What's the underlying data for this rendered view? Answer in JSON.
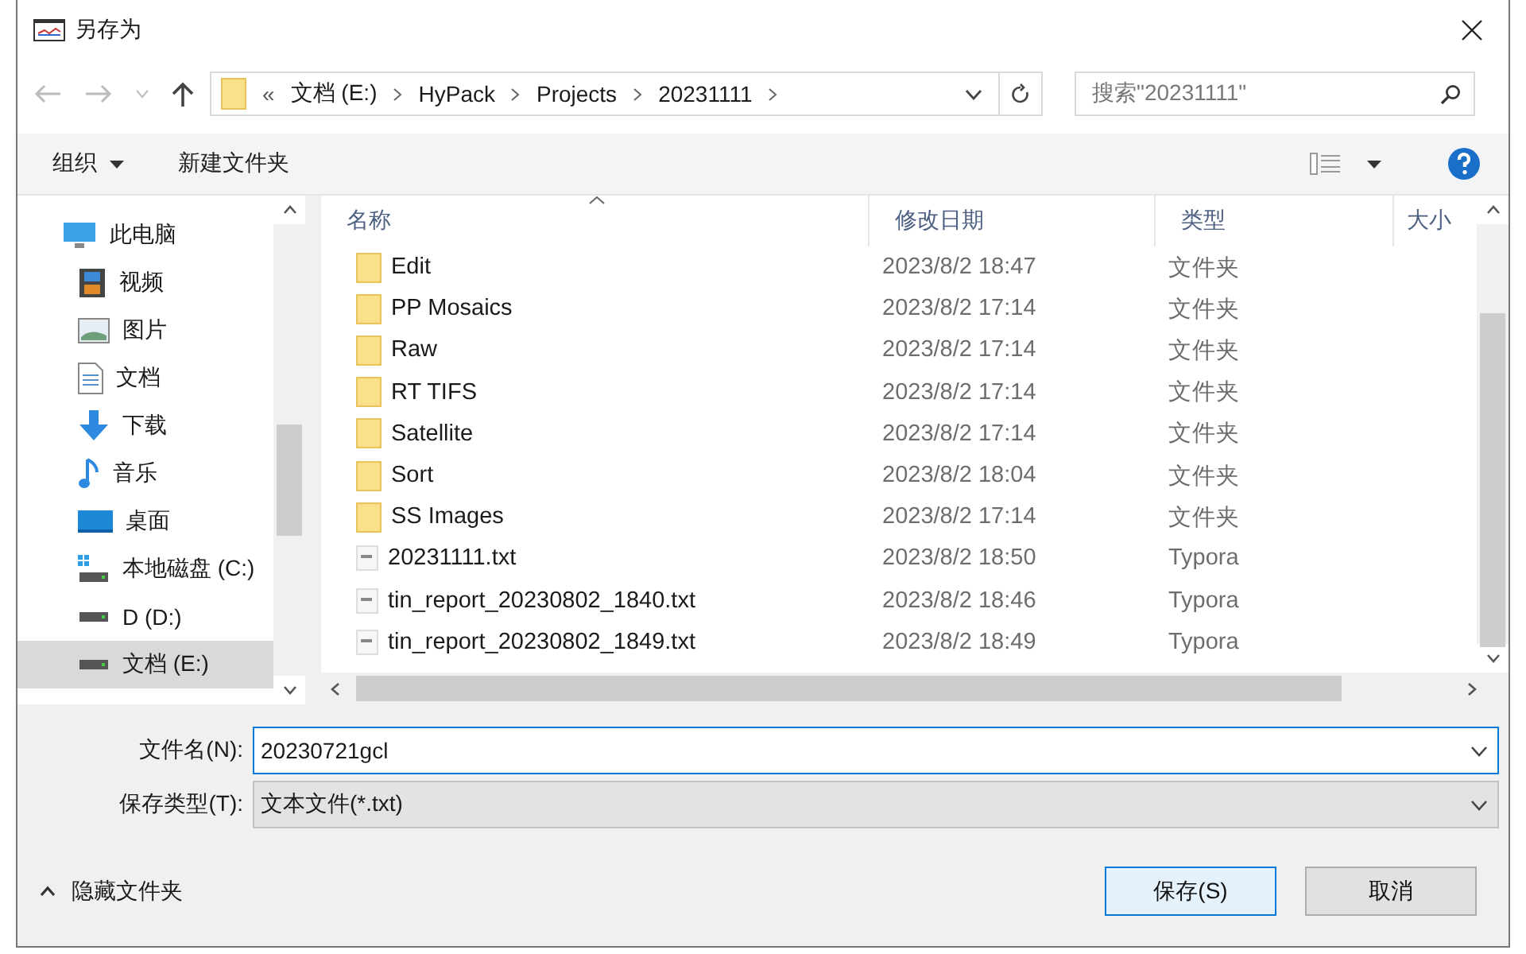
{
  "window": {
    "title": "另存为"
  },
  "address_bar": {
    "overflow": "«",
    "crumbs": [
      "文档 (E:)",
      "HyPack",
      "Projects",
      "20231111"
    ]
  },
  "search": {
    "placeholder": "搜索\"20231111\""
  },
  "toolbar": {
    "organize": "组织",
    "new_folder": "新建文件夹"
  },
  "sidebar": {
    "items": [
      {
        "label": "此电脑",
        "kind": "pc",
        "selected": false,
        "children": [
          {
            "label": "视频",
            "kind": "video",
            "selected": false
          },
          {
            "label": "图片",
            "kind": "pictures",
            "selected": false
          },
          {
            "label": "文档",
            "kind": "documents",
            "selected": false
          },
          {
            "label": "下载",
            "kind": "downloads",
            "selected": false
          },
          {
            "label": "音乐",
            "kind": "music",
            "selected": false
          },
          {
            "label": "桌面",
            "kind": "desktop",
            "selected": false
          },
          {
            "label": "本地磁盘 (C:)",
            "kind": "system-drive",
            "selected": false
          },
          {
            "label": "D (D:)",
            "kind": "drive",
            "selected": false
          },
          {
            "label": "文档 (E:)",
            "kind": "drive",
            "selected": true
          }
        ]
      }
    ]
  },
  "table": {
    "columns": [
      "名称",
      "修改日期",
      "类型",
      "大小"
    ],
    "rows": [
      {
        "name": "Edit",
        "date": "2023/8/2 18:47",
        "type": "文件夹",
        "kind": "folder"
      },
      {
        "name": "PP Mosaics",
        "date": "2023/8/2 17:14",
        "type": "文件夹",
        "kind": "folder"
      },
      {
        "name": "Raw",
        "date": "2023/8/2 17:14",
        "type": "文件夹",
        "kind": "folder"
      },
      {
        "name": "RT TIFS",
        "date": "2023/8/2 17:14",
        "type": "文件夹",
        "kind": "folder"
      },
      {
        "name": "Satellite",
        "date": "2023/8/2 17:14",
        "type": "文件夹",
        "kind": "folder"
      },
      {
        "name": "Sort",
        "date": "2023/8/2 18:04",
        "type": "文件夹",
        "kind": "folder"
      },
      {
        "name": "SS Images",
        "date": "2023/8/2 17:14",
        "type": "文件夹",
        "kind": "folder"
      },
      {
        "name": "20231111.txt",
        "date": "2023/8/2 18:50",
        "type": "Typora",
        "kind": "file"
      },
      {
        "name": "tin_report_20230802_1840.txt",
        "date": "2023/8/2 18:46",
        "type": "Typora",
        "kind": "file"
      },
      {
        "name": "tin_report_20230802_1849.txt",
        "date": "2023/8/2 18:49",
        "type": "Typora",
        "kind": "file"
      }
    ]
  },
  "form": {
    "filename_label": "文件名(N):",
    "filename": "20230721gcl",
    "filetype_label": "保存类型(T):",
    "filetype": "文本文件(*.txt)"
  },
  "footer": {
    "hide_folders": "隐藏文件夹",
    "save": "保存(S)",
    "cancel": "取消"
  }
}
